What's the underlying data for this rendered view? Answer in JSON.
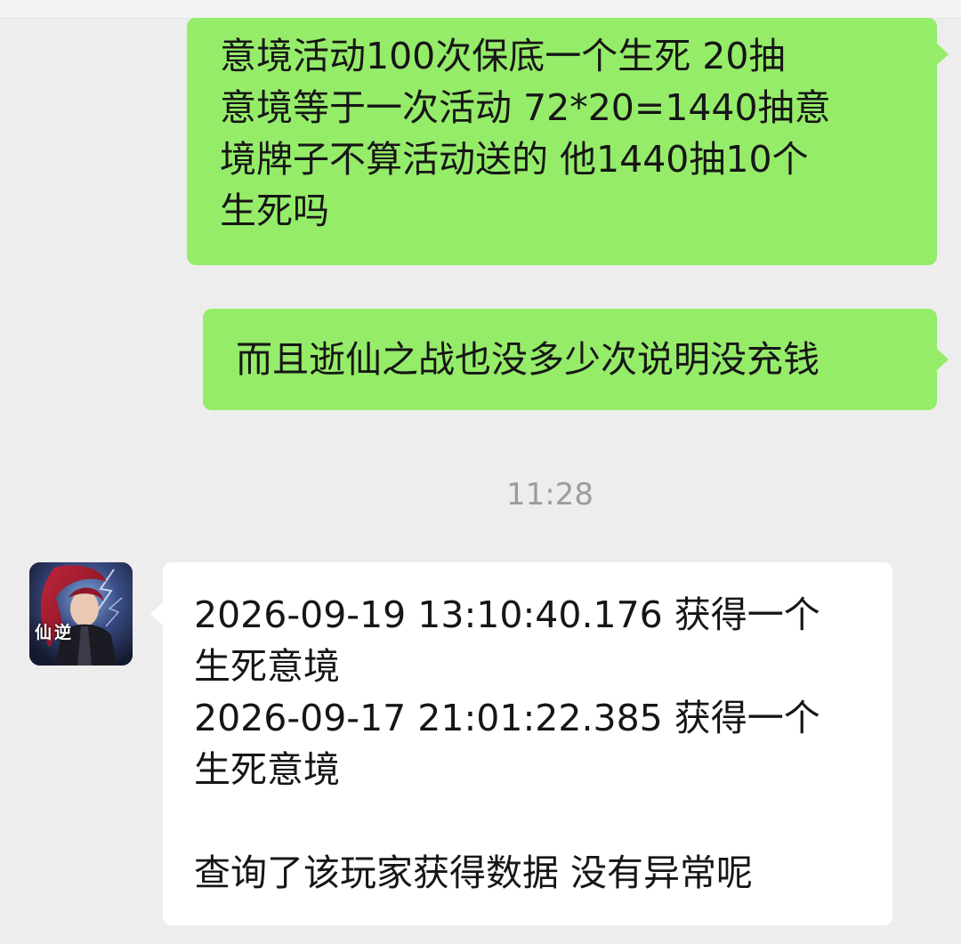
{
  "chat": {
    "messages": [
      {
        "direction": "outgoing",
        "lines": [
          "意境活动100次保底一个生死  20抽",
          "意境等于一次活动  72*20=1440抽意",
          "境牌子不算活动送的  他1440抽10个",
          "生死吗"
        ]
      },
      {
        "direction": "outgoing",
        "lines": [
          "而且逝仙之战也没多少次说明没充钱"
        ]
      },
      {
        "direction": "incoming",
        "avatar_icon": "game-avatar-icon",
        "avatar_text": "仙逆",
        "lines": [
          "2026-09-19 13:10:40.176 获得一个",
          "生死意境",
          "2026-09-17 21:01:22.385 获得一个",
          "生死意境",
          "",
          "查询了该玩家获得数据 没有异常呢"
        ]
      }
    ],
    "timestamp": "11:28"
  },
  "colors": {
    "background": "#ededed",
    "outgoing_bubble": "#95ec69",
    "incoming_bubble": "#ffffff",
    "timestamp_text": "#9c9c9c",
    "message_text": "#161616"
  }
}
